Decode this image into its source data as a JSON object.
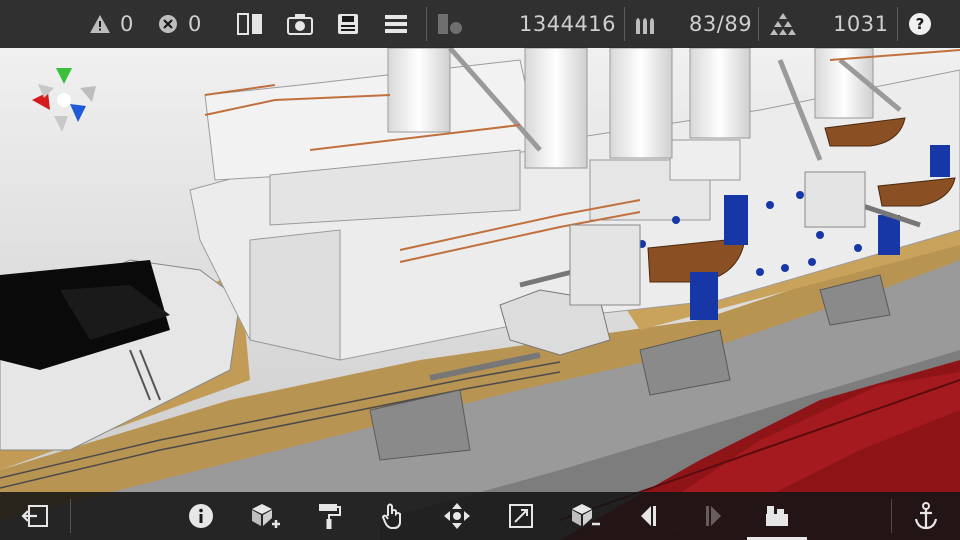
{
  "topbar": {
    "warnings_count": "0",
    "errors_count": "0",
    "polygon_count": "1344416",
    "parts_count": "83/89",
    "components_count": "1031"
  },
  "icons": {
    "warning": "warning-triangle-icon",
    "error": "error-circle-icon",
    "split_view": "split-view-icon",
    "camera": "camera-icon",
    "save": "save-icon",
    "menu": "menu-icon",
    "layers": "layers-icon",
    "ammo": "ammo-icon",
    "components": "stack-icon",
    "help": "help-icon"
  },
  "bottombar": {
    "tools": [
      "exit",
      "info",
      "add-part",
      "paint",
      "select",
      "move",
      "scale",
      "remove-part",
      "previous",
      "next",
      "crane",
      "anchor"
    ]
  },
  "colors": {
    "bar_bg": "#161616",
    "hull_red": "#8e1418",
    "deck_tan": "#b89452",
    "hull_gray": "#b0b0b0",
    "superstructure": "#ececec",
    "boat_brown": "#8a4f22",
    "porthole_blue": "#1737a6",
    "gizmo_green": "#39c13b",
    "gizmo_red": "#d51b1b",
    "gizmo_blue": "#1f59d6"
  }
}
